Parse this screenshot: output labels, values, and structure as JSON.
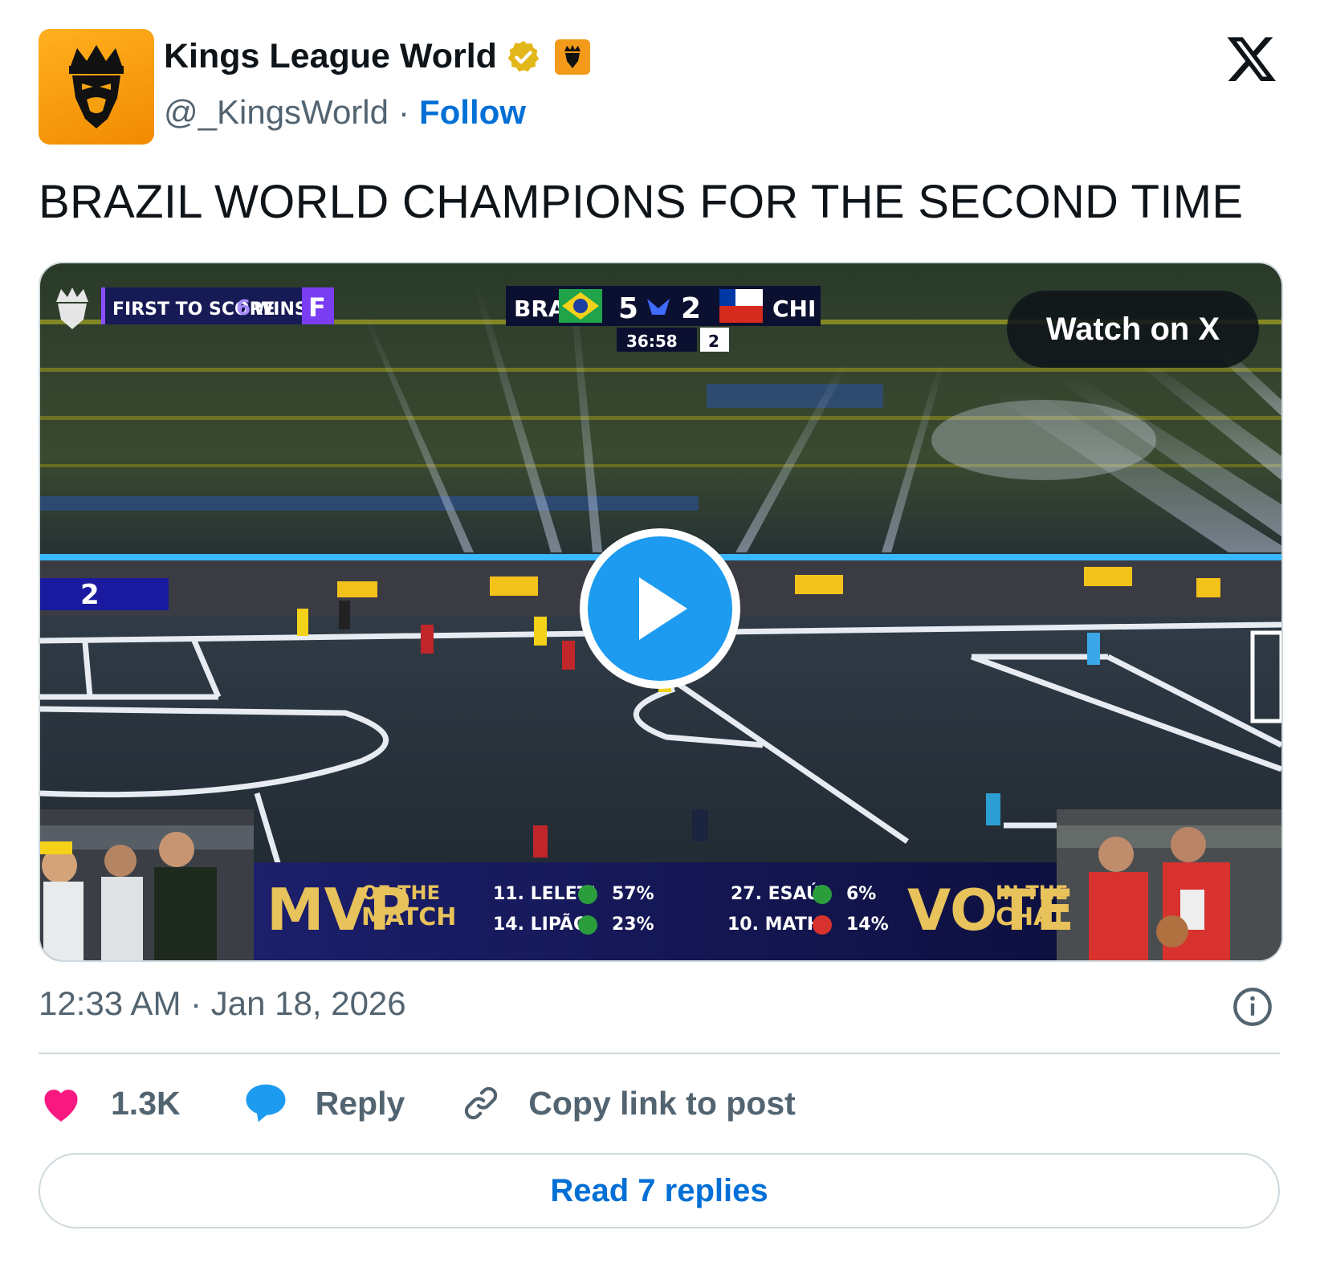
{
  "author": {
    "name": "Kings League World",
    "handle": "@_KingsWorld",
    "separator": "·",
    "follow_label": "Follow"
  },
  "post": {
    "text": "BRAZIL WORLD CHAMPIONS FOR THE SECOND TIME",
    "timestamp": "12:33 AM · Jan 18, 2026"
  },
  "media": {
    "watch_label": "Watch on X",
    "scoreboard": {
      "home": "BRA",
      "away": "CHI",
      "home_score": "5",
      "away_score": "2",
      "clock": "36:58",
      "period": "2",
      "rule_pre": "FIRST TO SCORE",
      "rule_num": "6",
      "rule_post": "WINS",
      "rule_badge": "F"
    },
    "mvp": {
      "title": "MVP",
      "sub1": "OF THE",
      "sub2": "MATCH",
      "vote": "VOTE",
      "vote_sub1": "IN THE",
      "vote_sub2": "CHAT",
      "candidates": [
        {
          "label": "11. LELETI",
          "pct": "57%"
        },
        {
          "label": "14. LIPÃO",
          "pct": "23%"
        },
        {
          "label": "27. ESAÚ",
          "pct": "6%"
        },
        {
          "label": "10. MATHI",
          "pct": "14%"
        }
      ]
    },
    "board_number": "2"
  },
  "actions": {
    "likes": "1.3K",
    "reply_label": "Reply",
    "copy_label": "Copy link to post"
  },
  "read_replies_label": "Read 7 replies",
  "colors": {
    "link_blue": "#006fd6",
    "play_blue": "#1d9bf0",
    "like_pink": "#f91880",
    "reply_blue": "#1d9bf0",
    "avatar_orange": "#f5a10f"
  }
}
